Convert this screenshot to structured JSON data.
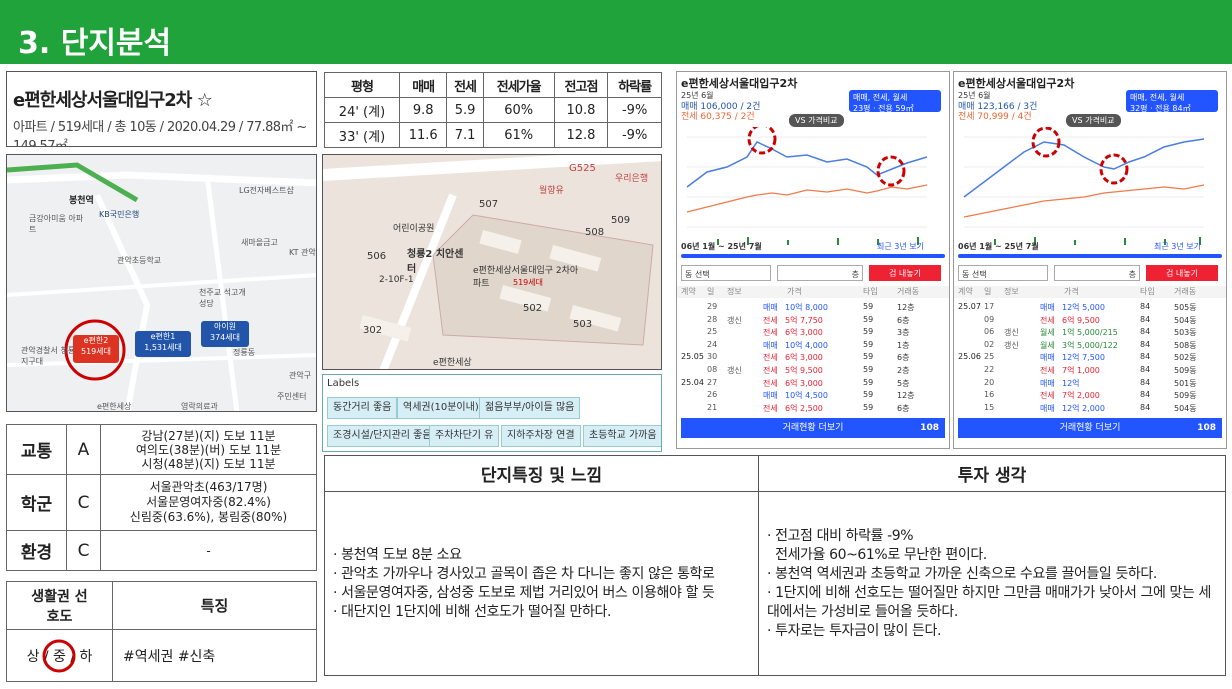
{
  "header": {
    "title": "3. 단지분석"
  },
  "complex": {
    "name": "e편한세상서울대입구2차 ☆",
    "summary": "아파트 / 519세대 / 총 10동 / 2020.04.29 / 77.88㎡ ~ 149.57㎡"
  },
  "price_table": {
    "headers": [
      "평형",
      "매매",
      "전세",
      "전세가율",
      "전고점",
      "하락률"
    ],
    "rows": [
      [
        "24' (계)",
        "9.8",
        "5.9",
        "60%",
        "10.8",
        "-9%"
      ],
      [
        "33' (계)",
        "11.6",
        "7.1",
        "61%",
        "12.8",
        "-9%"
      ]
    ]
  },
  "map1": {
    "labels": [
      "봉천역",
      "KB국민은행",
      "금강아미움 아파트",
      "LG전자베스트샵",
      "새마을금고",
      "KT 관악",
      "관악초등학교",
      "천주교 석고개성당",
      "관악경찰서 청룡지구대",
      "정룡동",
      "관악구",
      "e편한세상",
      "영락의료과",
      "주민센터"
    ],
    "markers": [
      {
        "name": "e편한2",
        "units": "519세대"
      },
      {
        "name": "e편한1",
        "units": "1,531세대"
      },
      {
        "name": "아이원",
        "units": "374세대"
      }
    ]
  },
  "map2": {
    "labels": [
      "G525",
      "월향유",
      "507",
      "어린이공원",
      "2-10F-1",
      "청룡2 치안센터",
      "e편한세상서울대입구 2차아파트",
      "519세대",
      "506",
      "508",
      "509",
      "502",
      "503",
      "302",
      "e편한세상",
      "우리은행"
    ]
  },
  "labels_panel": {
    "title": "Labels",
    "chips": [
      "동간거리 좋음",
      "역세권(10분이내)",
      "젊음부부/아이들 많음",
      "조경시설/단지관리 좋음",
      "주차차단기 유",
      "지하주차장 연결",
      "초등학교 가까움"
    ]
  },
  "phone1": {
    "title": "e편한세상서울대입구2차",
    "date": "25년 6월",
    "sale_avg": "매매 106,000 / 2건",
    "jeonse_avg": "전세 60,375 / 2건",
    "type_sel": "매매, 전세, 월세",
    "type_sub": "23평 · 전용 59㎡",
    "vs": "VS 가격비교",
    "period": "06년 1월 ~ 25년 7월",
    "recent": "최근 3년 보기",
    "dong": "동 선택",
    "floor": "층",
    "reset": "검 내놓기",
    "col_headers": [
      "계약",
      "일",
      "정보",
      "가격",
      "타입",
      "거래동"
    ],
    "rows": [
      {
        "ym": "",
        "d": "29",
        "info": "",
        "kind": "매매",
        "price": "10억 8,000",
        "type": "59",
        "bld": "12층"
      },
      {
        "ym": "",
        "d": "28",
        "info": "갱신",
        "kind": "전세",
        "price": "5억 7,750",
        "type": "59",
        "bld": "6층"
      },
      {
        "ym": "",
        "d": "25",
        "info": "",
        "kind": "전세",
        "price": "6억 3,000",
        "type": "59",
        "bld": "3층"
      },
      {
        "ym": "",
        "d": "24",
        "info": "",
        "kind": "매매",
        "price": "10억 4,000",
        "type": "59",
        "bld": "1층"
      },
      {
        "ym": "25.05",
        "d": "30",
        "info": "",
        "kind": "전세",
        "price": "6억 3,000",
        "type": "59",
        "bld": "6층"
      },
      {
        "ym": "",
        "d": "08",
        "info": "갱신",
        "kind": "전세",
        "price": "5억 9,500",
        "type": "59",
        "bld": "2층"
      },
      {
        "ym": "25.04",
        "d": "27",
        "info": "",
        "kind": "전세",
        "price": "6억 3,000",
        "type": "59",
        "bld": "5층"
      },
      {
        "ym": "",
        "d": "26",
        "info": "",
        "kind": "매매",
        "price": "10억 4,500",
        "type": "59",
        "bld": "12층"
      },
      {
        "ym": "",
        "d": "21",
        "info": "",
        "kind": "전세",
        "price": "6억 2,500",
        "type": "59",
        "bld": "6층"
      }
    ],
    "more": "거래현황 더보기",
    "count": "108"
  },
  "phone2": {
    "title": "e편한세상서울대입구2차",
    "date": "25년 6월",
    "sale_avg": "매매 123,166 / 3건",
    "jeonse_avg": "전세 70,999 / 4건",
    "type_sel": "매매, 전세, 월세",
    "type_sub": "32평 · 전용 84㎡",
    "vs": "VS 가격비교",
    "period": "06년 1월 ~ 25년 7월",
    "recent": "최근 3년 보기",
    "dong": "동 선택",
    "floor": "층",
    "reset": "검 내놓기",
    "col_headers": [
      "계약",
      "일",
      "정보",
      "가격",
      "타입",
      "거래동"
    ],
    "rows": [
      {
        "ym": "25.07",
        "d": "17",
        "info": "",
        "kind": "매매",
        "price": "12억 5,000",
        "type": "84",
        "bld": "505동"
      },
      {
        "ym": "",
        "d": "09",
        "info": "",
        "kind": "전세",
        "price": "6억 9,500",
        "type": "84",
        "bld": "504동"
      },
      {
        "ym": "",
        "d": "06",
        "info": "갱신",
        "kind": "월세",
        "price": "1억 5,000/215",
        "type": "84",
        "bld": "503동"
      },
      {
        "ym": "",
        "d": "02",
        "info": "갱신",
        "kind": "월세",
        "price": "3억 5,000/122",
        "type": "84",
        "bld": "508동"
      },
      {
        "ym": "25.06",
        "d": "25",
        "info": "",
        "kind": "매매",
        "price": "12억 7,500",
        "type": "84",
        "bld": "502동"
      },
      {
        "ym": "",
        "d": "22",
        "info": "",
        "kind": "전세",
        "price": "7억 1,000",
        "type": "84",
        "bld": "509동"
      },
      {
        "ym": "",
        "d": "20",
        "info": "",
        "kind": "매매",
        "price": "12억",
        "type": "84",
        "bld": "501동"
      },
      {
        "ym": "",
        "d": "16",
        "info": "",
        "kind": "전세",
        "price": "7억 2,000",
        "type": "84",
        "bld": "509동"
      },
      {
        "ym": "",
        "d": "15",
        "info": "",
        "kind": "매매",
        "price": "12억 2,000",
        "type": "84",
        "bld": "504동"
      }
    ],
    "more": "거래현황 더보기",
    "count": "108"
  },
  "evaluation": [
    {
      "cat": "교통",
      "grade": "A",
      "detail": [
        "강남(27분)(지) 도보 11분",
        "여의도(38분)(버) 도보 11분",
        "시청(48분)(지) 도보 11분"
      ]
    },
    {
      "cat": "학군",
      "grade": "C",
      "detail": [
        "서울관악초(463/17명)",
        "서울문영여자중(82.4%)",
        "신림중(63.6%), 봉림중(80%)"
      ]
    },
    {
      "cat": "환경",
      "grade": "C",
      "detail": [
        "-"
      ]
    }
  ],
  "preference": {
    "col1": "생활권 선호도",
    "col2": "특징",
    "value": "상 / 중 / 하",
    "feature": "#역세권 #신축"
  },
  "notes": {
    "left_title": "단지특징 및 느낌",
    "right_title": "투자 생각",
    "left": [
      "· 봉천역 도보 8분 소요",
      "· 관악초 가까우나 경사있고 골목이 좁은 차 다니는 좋지 않은 통학로",
      "· 서울문영여자중, 삼성중 도보로 제법 거리있어 버스 이용해야 할 듯",
      "· 대단지인 1단지에 비해 선호도가 떨어질 만하다."
    ],
    "right": [
      "· 전고점 대비 하락률 -9%",
      "  전세가율 60~61%로 무난한 편이다.",
      "· 봉천역 역세권과 초등학교 가까운 신축으로 수요를 끌어들일 듯하다.",
      "· 1단지에 비해 선호도는 떨어질만 하지만 그만큼 매매가가 낮아서 그에 맞는 세대에서는 가성비로 들어올 듯하다.",
      "· 투자로는 투자금이 많이 든다."
    ]
  }
}
